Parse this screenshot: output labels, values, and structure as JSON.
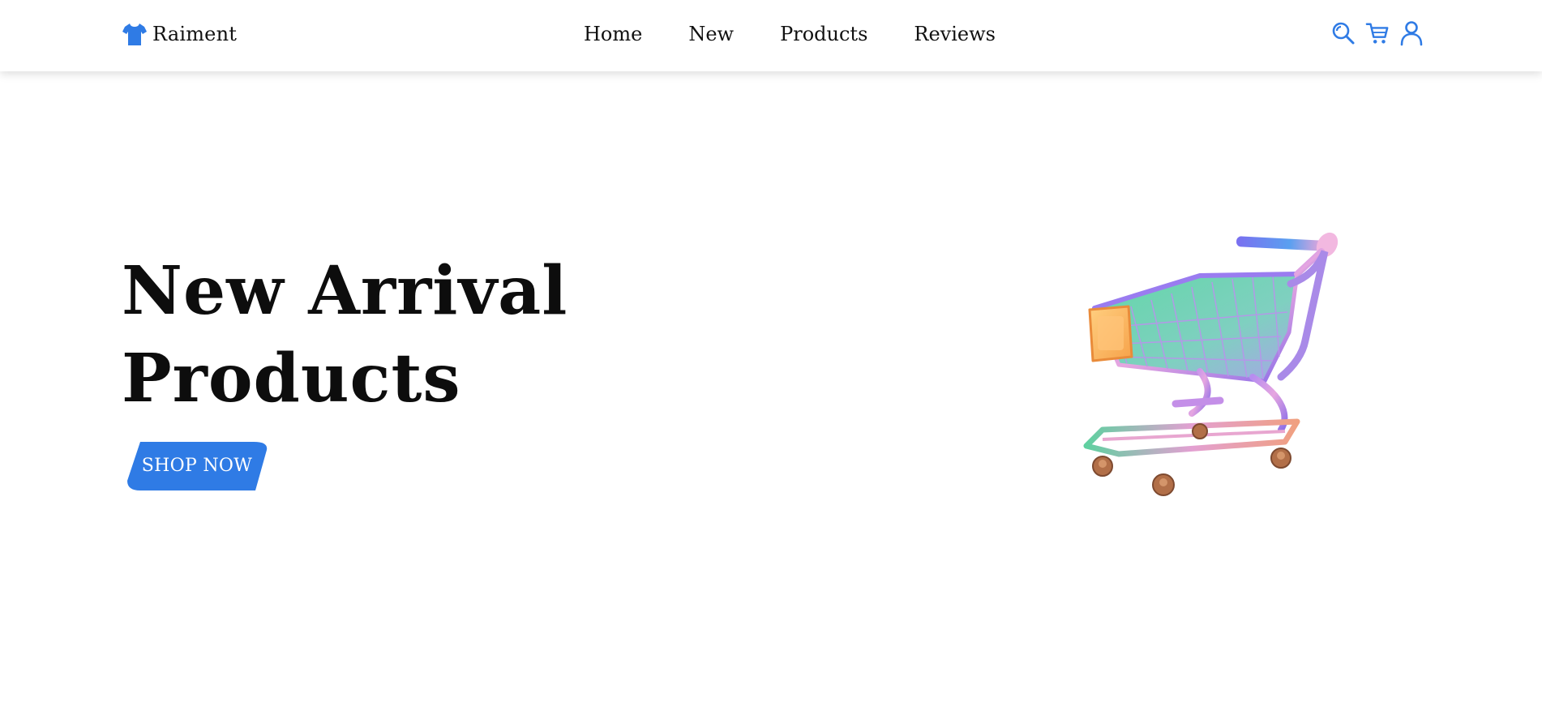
{
  "brand": {
    "name": "Raiment",
    "icon": "tshirt-icon"
  },
  "nav": {
    "links": [
      {
        "label": "Home"
      },
      {
        "label": "New"
      },
      {
        "label": "Products"
      },
      {
        "label": "Reviews"
      }
    ],
    "icons": [
      "search-icon",
      "cart-icon",
      "user-icon"
    ]
  },
  "hero": {
    "title_line_1": "New Arrival",
    "title_line_2": "Products",
    "cta_label": "SHOP NOW",
    "image": "shopping-cart-illustration"
  },
  "colors": {
    "accent": "#2f7be5",
    "text": "#111111",
    "background": "#ffffff"
  }
}
